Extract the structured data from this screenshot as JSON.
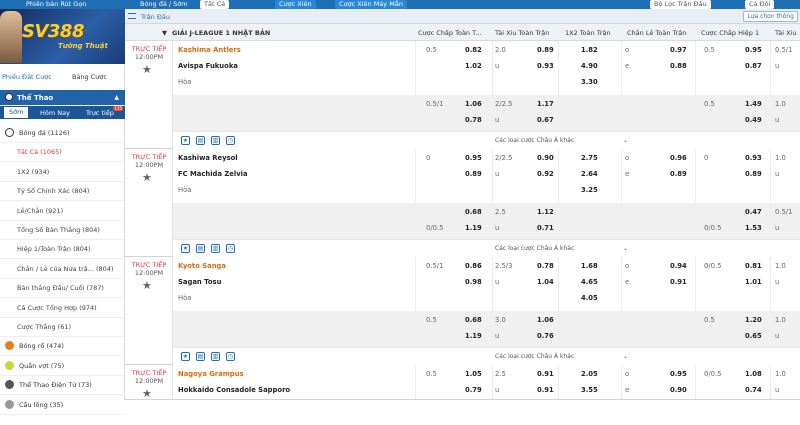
{
  "topbar": {
    "version_btn": "Phiên bản Rút Gọn",
    "breadcrumb": "Bóng đá / Sớm",
    "dropdown": "Tất Cả",
    "parlay_btn": "Cược Xiên",
    "parlay_machine_btn": "Cược Xiên Máy Mẫn",
    "filter_dropdown": "Bộ Lọc Trận Đấu",
    "sort_dropdown": "Cả Đôi"
  },
  "sidebar": {
    "brand": "SV388",
    "tagline": "Tường Thuật",
    "tabs": [
      "Phiếu Đặt Cược",
      "Bảng Cược"
    ],
    "sport_header": "Thể Thao",
    "time_tabs": [
      "Sớm",
      "Hôm Nay",
      "Trực tiếp"
    ],
    "live_badge": "115",
    "items": [
      {
        "label": "Bóng đá (1126)",
        "level": 1,
        "icon": "soccer-ball-icon"
      },
      {
        "label": "Tất Cả (1065)",
        "level": 2,
        "selected": true
      },
      {
        "label": "1X2 (934)",
        "level": 2
      },
      {
        "label": "Tỷ Số Chính Xác (804)",
        "level": 2
      },
      {
        "label": "Lẻ/Chẵn (921)",
        "level": 2
      },
      {
        "label": "Tổng Số Bàn Thắng (804)",
        "level": 2
      },
      {
        "label": "Hiệp 1/Toàn Trận (804)",
        "level": 2
      },
      {
        "label": "Chẵn / Lẻ của Nửa trậ... (804)",
        "level": 2
      },
      {
        "label": "Bàn thắng Đầu/ Cuối (787)",
        "level": 2
      },
      {
        "label": "Cá Cược Tổng Hợp (974)",
        "level": 2
      },
      {
        "label": "Cược Thắng (61)",
        "level": 2
      },
      {
        "label": "Bóng rổ (474)",
        "level": 1,
        "icon": "basketball-icon"
      },
      {
        "label": "Quần vợt (75)",
        "level": 1,
        "icon": "tennis-ball-icon"
      },
      {
        "label": "Thể Thao Điện Tử (73)",
        "level": 1,
        "icon": "esports-icon"
      },
      {
        "label": "Cầu lông (35)",
        "level": 1,
        "icon": "badminton-icon"
      }
    ]
  },
  "content": {
    "crumb_title": "Trận Đấu",
    "filter_btn": "Lựa chọn thông",
    "league": "GIẢI J-LEAGUE 1 NHẬT BẢN",
    "columns": [
      "Cược Chấp Toàn T...",
      "Tài Xỉu Toàn Trận",
      "1X2 Toàn Trận",
      "Chẵn Lẻ Toàn Trận",
      "Cược Chấp Hiệp 1",
      "Tài Xỉu"
    ],
    "more_label": "Các loại cược Châu Á khác",
    "live_label": "TRỰC TIẾP",
    "matches": [
      {
        "time": "12:00PM",
        "home": "Kashima Antlers",
        "away": "Avispa Fukuoka",
        "draw": "Hòa",
        "home_fav": true,
        "rows": [
          {
            "hdp": "0.5",
            "hdp_o": "0.82",
            "ou": "2.0",
            "ou_o": "0.89",
            "x12": "1.82",
            "oe_l": "o",
            "oe": "0.97",
            "h1": "0.5",
            "h1_o": "0.95",
            "tx": "0.5/1"
          },
          {
            "hdp": "",
            "hdp_o": "1.02",
            "ou": "u",
            "ou_o": "0.93",
            "x12": "4.90",
            "oe_l": "e",
            "oe": "0.88",
            "h1": "",
            "h1_o": "0.87",
            "tx": "u"
          },
          {
            "hdp": "",
            "hdp_o": "",
            "ou": "",
            "ou_o": "",
            "x12": "3.30",
            "oe_l": "",
            "oe": "",
            "h1": "",
            "h1_o": "",
            "tx": ""
          }
        ],
        "extra": [
          {
            "hdp": "0.5/1",
            "hdp_o": "1.06",
            "ou": "2/2.5",
            "ou_o": "1.17",
            "h1": "0.5",
            "h1_o": "1.49",
            "tx": "1.0"
          },
          {
            "hdp": "",
            "hdp_o": "0.78",
            "ou": "u",
            "ou_o": "0.67",
            "h1": "",
            "h1_o": "0.49",
            "tx": "u"
          }
        ]
      },
      {
        "time": "12:00PM",
        "home": "Kashiwa Reysol",
        "away": "FC Machida Zelvia",
        "draw": "Hòa",
        "home_fav": false,
        "rows": [
          {
            "hdp": "0",
            "hdp_o": "0.95",
            "ou": "2/2.5",
            "ou_o": "0.90",
            "x12": "2.75",
            "oe_l": "o",
            "oe": "0.96",
            "h1": "0",
            "h1_o": "0.93",
            "tx": "1.0"
          },
          {
            "hdp": "",
            "hdp_o": "0.89",
            "ou": "u",
            "ou_o": "0.92",
            "x12": "2.64",
            "oe_l": "e",
            "oe": "0.89",
            "h1": "",
            "h1_o": "0.89",
            "tx": "u"
          },
          {
            "hdp": "",
            "hdp_o": "",
            "ou": "",
            "ou_o": "",
            "x12": "3.25",
            "oe_l": "",
            "oe": "",
            "h1": "",
            "h1_o": "",
            "tx": ""
          }
        ],
        "extra": [
          {
            "hdp": "",
            "hdp_o": "0.68",
            "ou": "2.5",
            "ou_o": "1.12",
            "h1": "",
            "h1_o": "0.47",
            "tx": "0.5/1"
          },
          {
            "hdp": "0/0.5",
            "hdp_o": "1.19",
            "ou": "u",
            "ou_o": "0.71",
            "h1": "0/0.5",
            "h1_o": "1.53",
            "tx": "u"
          }
        ]
      },
      {
        "time": "12:00PM",
        "home": "Kyoto Sanga",
        "away": "Sagan Tosu",
        "draw": "Hòa",
        "home_fav": true,
        "rows": [
          {
            "hdp": "0.5/1",
            "hdp_o": "0.86",
            "ou": "2.5/3",
            "ou_o": "0.78",
            "x12": "1.68",
            "oe_l": "o",
            "oe": "0.94",
            "h1": "0/0.5",
            "h1_o": "0.81",
            "tx": "1.0"
          },
          {
            "hdp": "",
            "hdp_o": "0.98",
            "ou": "u",
            "ou_o": "1.04",
            "x12": "4.65",
            "oe_l": "e",
            "oe": "0.91",
            "h1": "",
            "h1_o": "1.01",
            "tx": "u"
          },
          {
            "hdp": "",
            "hdp_o": "",
            "ou": "",
            "ou_o": "",
            "x12": "4.05",
            "oe_l": "",
            "oe": "",
            "h1": "",
            "h1_o": "",
            "tx": ""
          }
        ],
        "extra": [
          {
            "hdp": "0.5",
            "hdp_o": "0.68",
            "ou": "3.0",
            "ou_o": "1.06",
            "h1": "0.5",
            "h1_o": "1.20",
            "tx": "1.0"
          },
          {
            "hdp": "",
            "hdp_o": "1.19",
            "ou": "u",
            "ou_o": "0.76",
            "h1": "",
            "h1_o": "0.65",
            "tx": "u"
          }
        ]
      },
      {
        "time": "12:00PM",
        "home": "Nagoya Grampus",
        "away": "Hokkaido Consadole Sapporo",
        "draw": "",
        "home_fav": true,
        "rows": [
          {
            "hdp": "0.5",
            "hdp_o": "1.05",
            "ou": "2.5",
            "ou_o": "0.91",
            "x12": "2.05",
            "oe_l": "o",
            "oe": "0.95",
            "h1": "0/0.5",
            "h1_o": "1.08",
            "tx": "1.0"
          },
          {
            "hdp": "",
            "hdp_o": "0.79",
            "ou": "u",
            "ou_o": "0.91",
            "x12": "3.55",
            "oe_l": "e",
            "oe": "0.90",
            "h1": "",
            "h1_o": "0.74",
            "tx": "u"
          }
        ],
        "extra": []
      }
    ]
  },
  "colors": {
    "primary": "#1f6fb5",
    "live_red": "#d9363e",
    "home_orange": "#e06a10",
    "gold": "#f4d03f"
  }
}
